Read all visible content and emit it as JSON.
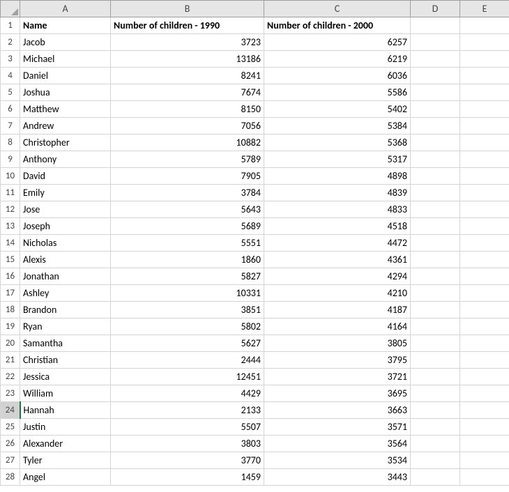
{
  "columns": [
    "A",
    "B",
    "C",
    "D",
    "E"
  ],
  "header": {
    "A": "Name",
    "B": "Number of children - 1990",
    "C": "Number of children - 2000"
  },
  "rows": [
    {
      "n": "2",
      "A": "Jacob",
      "B": "3723",
      "C": "6257"
    },
    {
      "n": "3",
      "A": "Michael",
      "B": "13186",
      "C": "6219"
    },
    {
      "n": "4",
      "A": "Daniel",
      "B": "8241",
      "C": "6036"
    },
    {
      "n": "5",
      "A": "Joshua",
      "B": "7674",
      "C": "5586"
    },
    {
      "n": "6",
      "A": "Matthew",
      "B": "8150",
      "C": "5402"
    },
    {
      "n": "7",
      "A": "Andrew",
      "B": "7056",
      "C": "5384"
    },
    {
      "n": "8",
      "A": "Christopher",
      "B": "10882",
      "C": "5368"
    },
    {
      "n": "9",
      "A": "Anthony",
      "B": "5789",
      "C": "5317"
    },
    {
      "n": "10",
      "A": "David",
      "B": "7905",
      "C": "4898"
    },
    {
      "n": "11",
      "A": "Emily",
      "B": "3784",
      "C": "4839"
    },
    {
      "n": "12",
      "A": "Jose",
      "B": "5643",
      "C": "4833"
    },
    {
      "n": "13",
      "A": "Joseph",
      "B": "5689",
      "C": "4518"
    },
    {
      "n": "14",
      "A": "Nicholas",
      "B": "5551",
      "C": "4472"
    },
    {
      "n": "15",
      "A": "Alexis",
      "B": "1860",
      "C": "4361"
    },
    {
      "n": "16",
      "A": "Jonathan",
      "B": "5827",
      "C": "4294"
    },
    {
      "n": "17",
      "A": "Ashley",
      "B": "10331",
      "C": "4210"
    },
    {
      "n": "18",
      "A": "Brandon",
      "B": "3851",
      "C": "4187"
    },
    {
      "n": "19",
      "A": "Ryan",
      "B": "5802",
      "C": "4164"
    },
    {
      "n": "20",
      "A": "Samantha",
      "B": "5627",
      "C": "3805"
    },
    {
      "n": "21",
      "A": "Christian",
      "B": "2444",
      "C": "3795"
    },
    {
      "n": "22",
      "A": "Jessica",
      "B": "12451",
      "C": "3721"
    },
    {
      "n": "23",
      "A": "William",
      "B": "4429",
      "C": "3695"
    },
    {
      "n": "24",
      "A": "Hannah",
      "B": "2133",
      "C": "3663"
    },
    {
      "n": "25",
      "A": "Justin",
      "B": "5507",
      "C": "3571"
    },
    {
      "n": "26",
      "A": "Alexander",
      "B": "3803",
      "C": "3564"
    },
    {
      "n": "27",
      "A": "Tyler",
      "B": "3770",
      "C": "3534"
    },
    {
      "n": "28",
      "A": "Angel",
      "B": "1459",
      "C": "3443"
    }
  ],
  "selected_row": "24",
  "chart_data": {
    "type": "table",
    "title": "",
    "columns": [
      "Name",
      "Number of children - 1990",
      "Number of children - 2000"
    ],
    "data": [
      [
        "Jacob",
        3723,
        6257
      ],
      [
        "Michael",
        13186,
        6219
      ],
      [
        "Daniel",
        8241,
        6036
      ],
      [
        "Joshua",
        7674,
        5586
      ],
      [
        "Matthew",
        8150,
        5402
      ],
      [
        "Andrew",
        7056,
        5384
      ],
      [
        "Christopher",
        10882,
        5368
      ],
      [
        "Anthony",
        5789,
        5317
      ],
      [
        "David",
        7905,
        4898
      ],
      [
        "Emily",
        3784,
        4839
      ],
      [
        "Jose",
        5643,
        4833
      ],
      [
        "Joseph",
        5689,
        4518
      ],
      [
        "Nicholas",
        5551,
        4472
      ],
      [
        "Alexis",
        1860,
        4361
      ],
      [
        "Jonathan",
        5827,
        4294
      ],
      [
        "Ashley",
        10331,
        4210
      ],
      [
        "Brandon",
        3851,
        4187
      ],
      [
        "Ryan",
        5802,
        4164
      ],
      [
        "Samantha",
        5627,
        3805
      ],
      [
        "Christian",
        2444,
        3795
      ],
      [
        "Jessica",
        12451,
        3721
      ],
      [
        "William",
        4429,
        3695
      ],
      [
        "Hannah",
        2133,
        3663
      ],
      [
        "Justin",
        5507,
        3571
      ],
      [
        "Alexander",
        3803,
        3564
      ],
      [
        "Tyler",
        3770,
        3534
      ],
      [
        "Angel",
        1459,
        3443
      ]
    ]
  }
}
